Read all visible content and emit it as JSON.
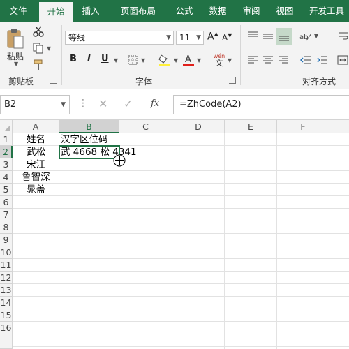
{
  "tabs": [
    {
      "label": "文件",
      "active": false
    },
    {
      "label": "开始",
      "active": true
    },
    {
      "label": "插入",
      "active": false
    },
    {
      "label": "页面布局",
      "active": false
    },
    {
      "label": "公式",
      "active": false
    },
    {
      "label": "数据",
      "active": false
    },
    {
      "label": "审阅",
      "active": false
    },
    {
      "label": "视图",
      "active": false
    },
    {
      "label": "开发工具",
      "active": false
    }
  ],
  "ribbon": {
    "clipboard": {
      "label": "剪贴板",
      "paste_label": "粘贴"
    },
    "font": {
      "label": "字体",
      "font_name": "等线",
      "font_size": "11",
      "bold": "B",
      "italic": "I",
      "underline": "U",
      "grow": "A",
      "shrink": "A",
      "phonetic_top": "wén",
      "phonetic_bottom": "文"
    },
    "alignment": {
      "label": "对齐方式"
    }
  },
  "formula_bar": {
    "name_box": "B2",
    "formula": "=ZhCode(A2)",
    "fx": "fx"
  },
  "grid": {
    "columns": [
      "A",
      "B",
      "C",
      "D",
      "E",
      "F"
    ],
    "rows": [
      "1",
      "2",
      "3",
      "4",
      "5",
      "6",
      "7",
      "8",
      "9",
      "10",
      "11",
      "12",
      "13",
      "14",
      "15",
      "16"
    ],
    "active_cell": "B2",
    "cells": {
      "A1": "姓名",
      "B1": "汉字区位码",
      "A2": "武松",
      "B2": "武 4668 松 4341",
      "A3": "宋江",
      "A4": "鲁智深",
      "A5": "晁盖"
    }
  },
  "colors": {
    "brand": "#217346",
    "ribbon_bg": "#f3f3f3",
    "font_color_red": "#e0201b",
    "fill_yellow": "#ffef3a"
  }
}
